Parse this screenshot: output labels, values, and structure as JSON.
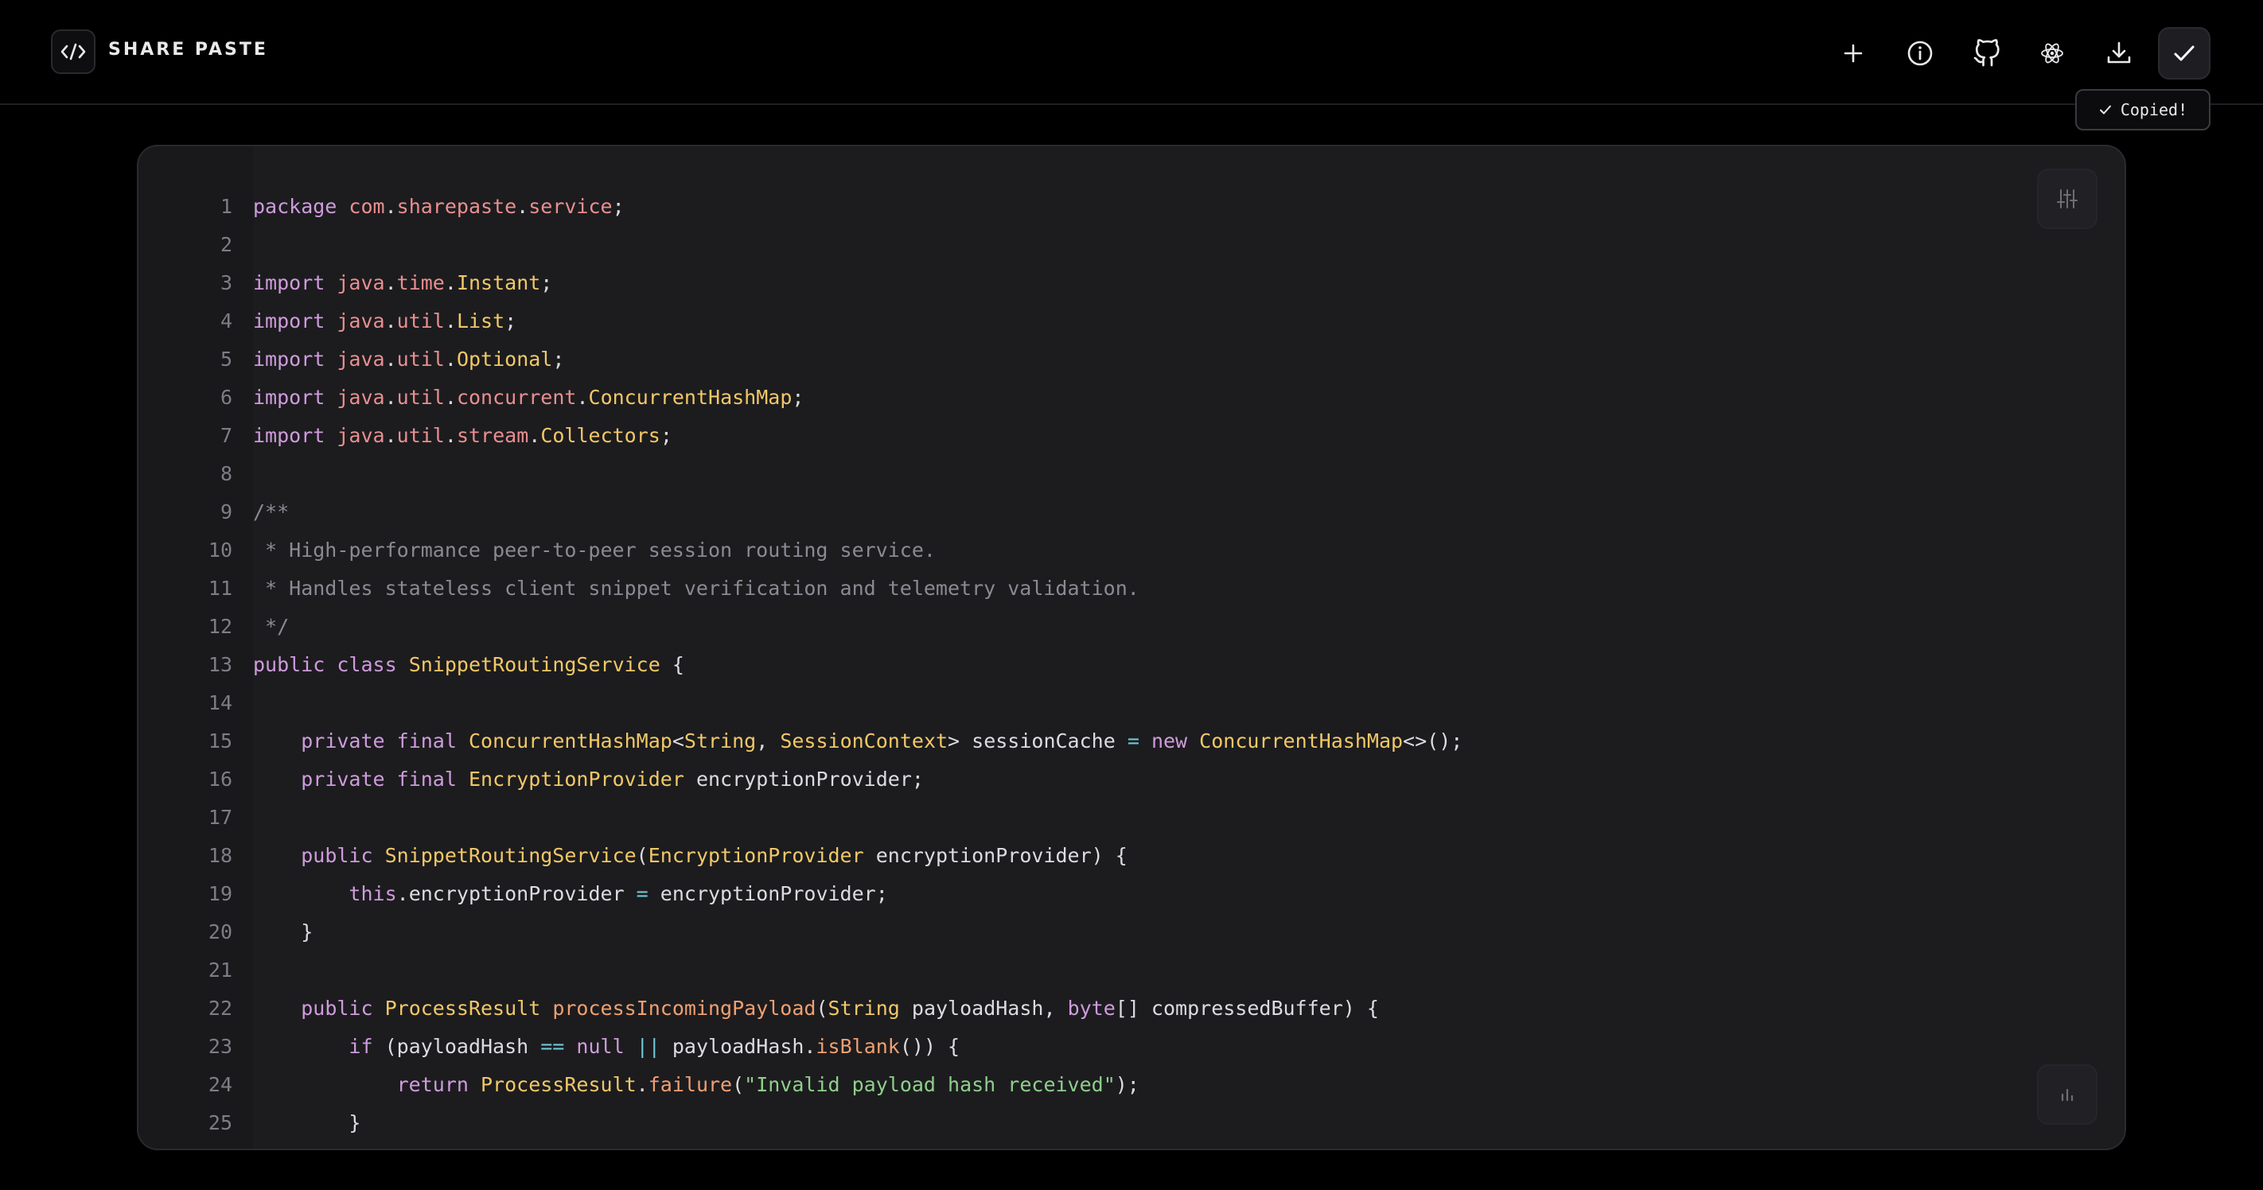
{
  "header": {
    "brand": "SHARE PASTE",
    "tooltip": "Copied!"
  },
  "icons": {
    "logo": "code-brackets-icon",
    "new": "plus-icon",
    "info": "info-icon",
    "github": "github-icon",
    "theme": "atom-icon",
    "download": "download-icon",
    "copy": "check-icon",
    "settings": "sliders-icon",
    "stats": "bar-chart-icon"
  },
  "colors": {
    "keyword": "#cf9bdc",
    "package": "#e98f8f",
    "type": "#f2c866",
    "function": "#f0a070",
    "comment": "#8a8a93",
    "string": "#8fcf8a",
    "operator": "#6fc6d6",
    "plain": "#dcdce0",
    "background": "#1c1c1f"
  },
  "code": {
    "language": "java",
    "lines": [
      {
        "n": "1",
        "tokens": [
          [
            "package",
            "kw"
          ],
          [
            " ",
            "p"
          ],
          [
            "com",
            "pk"
          ],
          [
            ".",
            "p"
          ],
          [
            "sharepaste",
            "pk"
          ],
          [
            ".",
            "p"
          ],
          [
            "service",
            "pk"
          ],
          [
            ";",
            "p"
          ]
        ]
      },
      {
        "n": "2",
        "tokens": []
      },
      {
        "n": "3",
        "tokens": [
          [
            "import",
            "kw"
          ],
          [
            " ",
            "p"
          ],
          [
            "java",
            "pk"
          ],
          [
            ".",
            "p"
          ],
          [
            "time",
            "pk"
          ],
          [
            ".",
            "p"
          ],
          [
            "Instant",
            "ty"
          ],
          [
            ";",
            "p"
          ]
        ]
      },
      {
        "n": "4",
        "tokens": [
          [
            "import",
            "kw"
          ],
          [
            " ",
            "p"
          ],
          [
            "java",
            "pk"
          ],
          [
            ".",
            "p"
          ],
          [
            "util",
            "pk"
          ],
          [
            ".",
            "p"
          ],
          [
            "List",
            "ty"
          ],
          [
            ";",
            "p"
          ]
        ]
      },
      {
        "n": "5",
        "tokens": [
          [
            "import",
            "kw"
          ],
          [
            " ",
            "p"
          ],
          [
            "java",
            "pk"
          ],
          [
            ".",
            "p"
          ],
          [
            "util",
            "pk"
          ],
          [
            ".",
            "p"
          ],
          [
            "Optional",
            "ty"
          ],
          [
            ";",
            "p"
          ]
        ]
      },
      {
        "n": "6",
        "tokens": [
          [
            "import",
            "kw"
          ],
          [
            " ",
            "p"
          ],
          [
            "java",
            "pk"
          ],
          [
            ".",
            "p"
          ],
          [
            "util",
            "pk"
          ],
          [
            ".",
            "p"
          ],
          [
            "concurrent",
            "pk"
          ],
          [
            ".",
            "p"
          ],
          [
            "ConcurrentHashMap",
            "ty"
          ],
          [
            ";",
            "p"
          ]
        ]
      },
      {
        "n": "7",
        "tokens": [
          [
            "import",
            "kw"
          ],
          [
            " ",
            "p"
          ],
          [
            "java",
            "pk"
          ],
          [
            ".",
            "p"
          ],
          [
            "util",
            "pk"
          ],
          [
            ".",
            "p"
          ],
          [
            "stream",
            "pk"
          ],
          [
            ".",
            "p"
          ],
          [
            "Collectors",
            "ty"
          ],
          [
            ";",
            "p"
          ]
        ]
      },
      {
        "n": "8",
        "tokens": []
      },
      {
        "n": "9",
        "tokens": [
          [
            "/**",
            "cm"
          ]
        ]
      },
      {
        "n": "10",
        "tokens": [
          [
            " * High-performance peer-to-peer session routing service.",
            "cm"
          ]
        ]
      },
      {
        "n": "11",
        "tokens": [
          [
            " * Handles stateless client snippet verification and telemetry validation.",
            "cm"
          ]
        ]
      },
      {
        "n": "12",
        "tokens": [
          [
            " */",
            "cm"
          ]
        ]
      },
      {
        "n": "13",
        "tokens": [
          [
            "public",
            "kw"
          ],
          [
            " ",
            "p"
          ],
          [
            "class",
            "kw"
          ],
          [
            " ",
            "p"
          ],
          [
            "SnippetRoutingService",
            "ty"
          ],
          [
            " {",
            "p"
          ]
        ]
      },
      {
        "n": "14",
        "tokens": []
      },
      {
        "n": "15",
        "tokens": [
          [
            "    ",
            "p"
          ],
          [
            "private",
            "kw"
          ],
          [
            " ",
            "p"
          ],
          [
            "final",
            "kw"
          ],
          [
            " ",
            "p"
          ],
          [
            "ConcurrentHashMap",
            "ty"
          ],
          [
            "<",
            "p"
          ],
          [
            "String",
            "ty"
          ],
          [
            ", ",
            "p"
          ],
          [
            "SessionContext",
            "ty"
          ],
          [
            "> sessionCache ",
            "p"
          ],
          [
            "=",
            "op"
          ],
          [
            " ",
            "p"
          ],
          [
            "new",
            "kw"
          ],
          [
            " ",
            "p"
          ],
          [
            "ConcurrentHashMap",
            "ty"
          ],
          [
            "<>();",
            "p"
          ]
        ]
      },
      {
        "n": "16",
        "tokens": [
          [
            "    ",
            "p"
          ],
          [
            "private",
            "kw"
          ],
          [
            " ",
            "p"
          ],
          [
            "final",
            "kw"
          ],
          [
            " ",
            "p"
          ],
          [
            "EncryptionProvider",
            "ty"
          ],
          [
            " encryptionProvider;",
            "p"
          ]
        ]
      },
      {
        "n": "17",
        "tokens": []
      },
      {
        "n": "18",
        "tokens": [
          [
            "    ",
            "p"
          ],
          [
            "public",
            "kw"
          ],
          [
            " ",
            "p"
          ],
          [
            "SnippetRoutingService",
            "ty"
          ],
          [
            "(",
            "p"
          ],
          [
            "EncryptionProvider",
            "ty"
          ],
          [
            " encryptionProvider) {",
            "p"
          ]
        ]
      },
      {
        "n": "19",
        "tokens": [
          [
            "        ",
            "p"
          ],
          [
            "this",
            "kw"
          ],
          [
            ".encryptionProvider ",
            "p"
          ],
          [
            "=",
            "op"
          ],
          [
            " encryptionProvider;",
            "p"
          ]
        ]
      },
      {
        "n": "20",
        "tokens": [
          [
            "    }",
            "p"
          ]
        ]
      },
      {
        "n": "21",
        "tokens": []
      },
      {
        "n": "22",
        "tokens": [
          [
            "    ",
            "p"
          ],
          [
            "public",
            "kw"
          ],
          [
            " ",
            "p"
          ],
          [
            "ProcessResult",
            "ty"
          ],
          [
            " ",
            "p"
          ],
          [
            "processIncomingPayload",
            "fn"
          ],
          [
            "(",
            "p"
          ],
          [
            "String",
            "ty"
          ],
          [
            " payloadHash, ",
            "p"
          ],
          [
            "byte",
            "kw"
          ],
          [
            "[] compressedBuffer) {",
            "p"
          ]
        ]
      },
      {
        "n": "23",
        "tokens": [
          [
            "        ",
            "p"
          ],
          [
            "if",
            "kw"
          ],
          [
            " (payloadHash ",
            "p"
          ],
          [
            "==",
            "op"
          ],
          [
            " ",
            "p"
          ],
          [
            "null",
            "kw"
          ],
          [
            " ",
            "p"
          ],
          [
            "||",
            "op"
          ],
          [
            " payloadHash.",
            "p"
          ],
          [
            "isBlank",
            "fn"
          ],
          [
            "()) {",
            "p"
          ]
        ]
      },
      {
        "n": "24",
        "tokens": [
          [
            "            ",
            "p"
          ],
          [
            "return",
            "kw"
          ],
          [
            " ",
            "p"
          ],
          [
            "ProcessResult",
            "ty"
          ],
          [
            ".",
            "p"
          ],
          [
            "failure",
            "fn"
          ],
          [
            "(",
            "p"
          ],
          [
            "\"Invalid payload hash received\"",
            "st"
          ],
          [
            ");",
            "p"
          ]
        ]
      },
      {
        "n": "25",
        "tokens": [
          [
            "        }",
            "p"
          ]
        ]
      }
    ]
  }
}
